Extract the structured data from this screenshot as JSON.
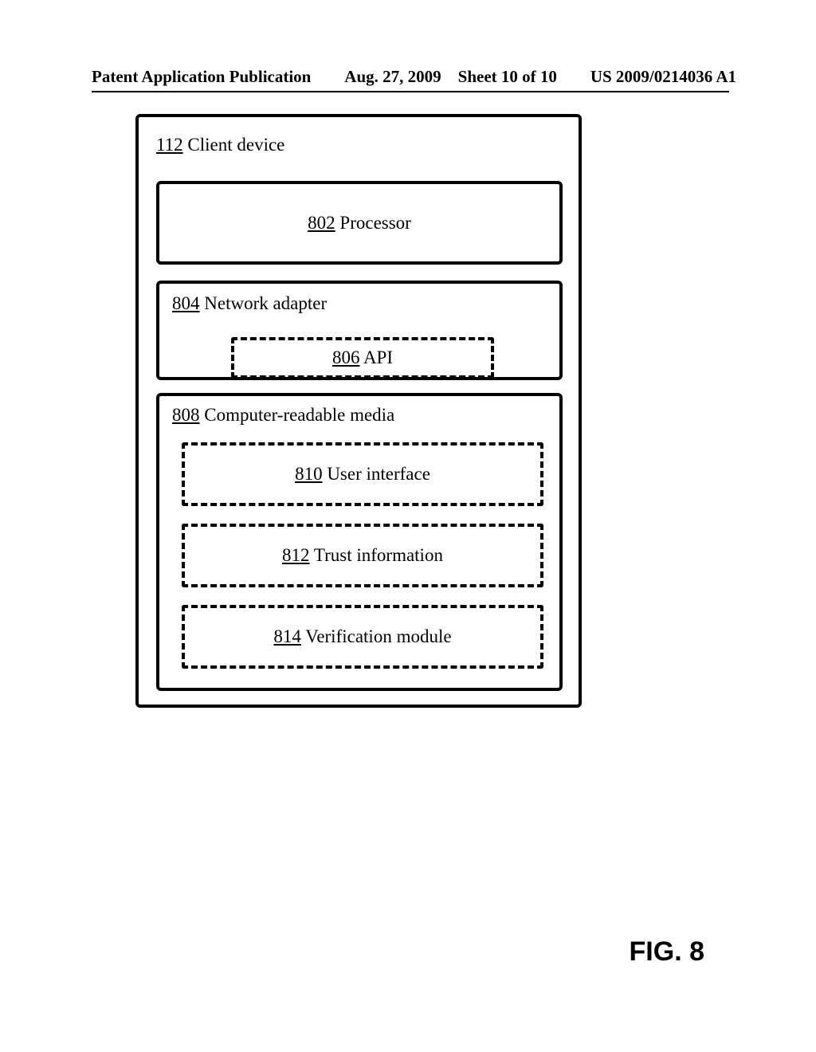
{
  "header": {
    "left": "Patent Application Publication",
    "date": "Aug. 27, 2009",
    "sheet": "Sheet 10 of 10",
    "pubno": "US 2009/0214036 A1"
  },
  "outer": {
    "ref": "112",
    "label": " Client device"
  },
  "processor": {
    "ref": "802",
    "label": " Processor"
  },
  "network": {
    "ref": "804",
    "label": " Network adapter"
  },
  "api": {
    "ref": "806",
    "label": " API"
  },
  "crm": {
    "ref": "808",
    "label": " Computer-readable media"
  },
  "ui": {
    "ref": "810",
    "label": " User interface"
  },
  "trust": {
    "ref": "812",
    "label": " Trust information"
  },
  "verify": {
    "ref": "814",
    "label": " Verification module"
  },
  "figure": "FIG. 8"
}
